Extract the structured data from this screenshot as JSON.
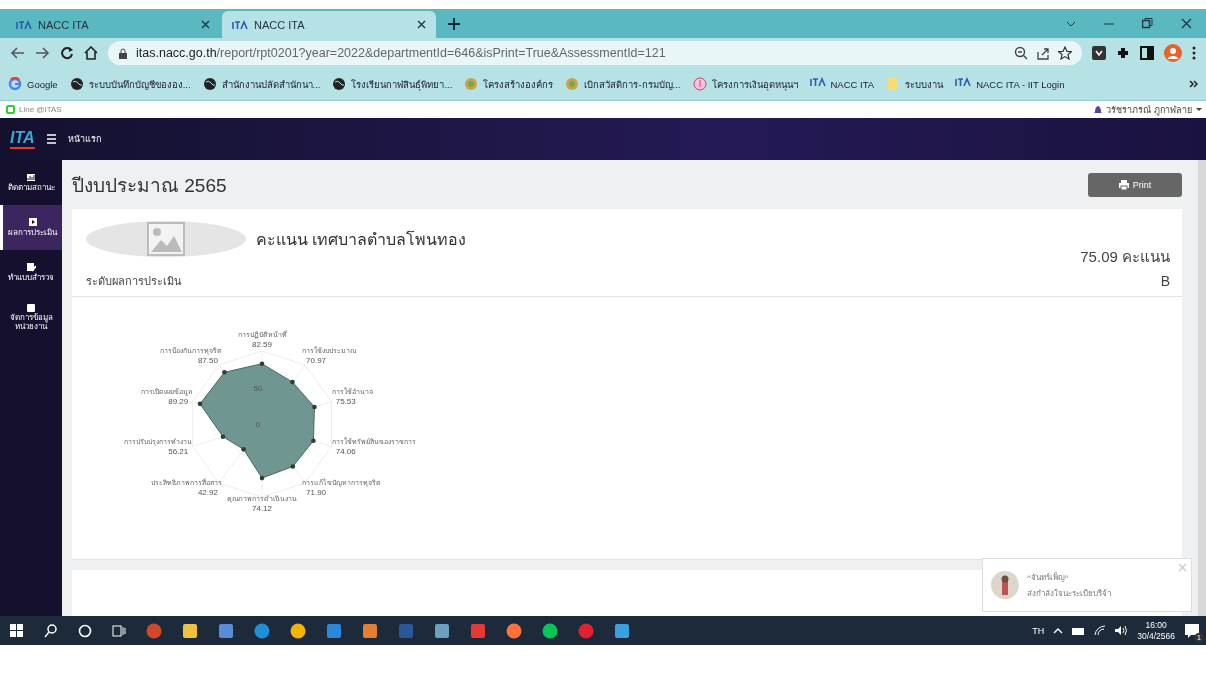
{
  "browser": {
    "tabs": [
      {
        "title": "NACC ITA",
        "selected": false
      },
      {
        "title": "NACC ITA",
        "selected": true
      }
    ],
    "url_host": "itas.nacc.go.th",
    "url_path": "/report/rpt0201?year=2022&departmentId=646&isPrint=True&AssessmentId=121",
    "bookmarks": [
      {
        "label": "Google",
        "kind": "google"
      },
      {
        "label": "ระบบบันทึกบัญชีขององ...",
        "kind": "globe"
      },
      {
        "label": "สำนักงานปลัดสำนักนา...",
        "kind": "globe"
      },
      {
        "label": "โรงเรียนกาฬสินธุ์พิทยา...",
        "kind": "globe"
      },
      {
        "label": "โครงสร้างองค์กร",
        "kind": "emblem"
      },
      {
        "label": "เบิกสวัสดิการ-กรมบัญ...",
        "kind": "emblem"
      },
      {
        "label": "โครงการเงินอุดหนุนฯ",
        "kind": "pink"
      },
      {
        "label": "NACC ITA",
        "kind": "ita"
      },
      {
        "label": "ระบบงาน",
        "kind": "folder"
      },
      {
        "label": "NACC ITA - IIT Login",
        "kind": "ita"
      }
    ]
  },
  "line_link": "Line @ITAS",
  "user": "วรัชราภรณ์ ภูกาฬลาย",
  "navbar": {
    "logo": "ITA",
    "title": "หน้าแรก"
  },
  "sidebar": {
    "items": [
      {
        "label": "ติดตามสถานะ",
        "selected": false
      },
      {
        "label": "ผลการประเมิน",
        "selected": true
      },
      {
        "label": "ทำแบบสำรวจ",
        "selected": false
      },
      {
        "label": "จัดการข้อมูลหน่วยงาน",
        "selected": false
      }
    ]
  },
  "page_title": "ปีงบประมาณ 2565",
  "print_button": "Print",
  "score_card": {
    "heading": "คะแนน เทศบาลตำบลโพนทอง",
    "score": "75.09 คะแนน",
    "level_label": "ระดับผลการประเมิน",
    "grade": "B"
  },
  "radar": {
    "ticks": [
      "50",
      "0"
    ],
    "axes_right": [
      {
        "label": "การปฏิบัติหน้าที่",
        "value": "82.59"
      },
      {
        "label": "การใช้งบประมาณ",
        "value": "70.97"
      },
      {
        "label": "การใช้อำนาจ",
        "value": "75.53"
      },
      {
        "label": "การใช้ทรัพย์สินของราชการ",
        "value": "74.06"
      },
      {
        "label": "การแก้ไขปัญหาการทุจริต",
        "value": "71.90"
      },
      {
        "label": "คุณภาพการดำเนินงาน",
        "value": "74.12"
      }
    ],
    "axes_left": [
      {
        "label": "การป้องกันการทุจริต",
        "value": "87.50"
      },
      {
        "label": "การเปิดเผยข้อมูล",
        "value": "89.29"
      },
      {
        "label": "การปรับปรุงการทำงาน",
        "value": "56.21"
      },
      {
        "label": "ประสิทธิภาพการสื่อสาร",
        "value": "42.92"
      }
    ]
  },
  "toast": {
    "name": "^จันทร์เพ็ญ^",
    "message": "ส่งกำลังใจนะระเบียบรีจ้า"
  },
  "taskbar": {
    "language": "TH",
    "time": "16:00",
    "date": "30/4/2566",
    "notification_count": "1"
  }
}
